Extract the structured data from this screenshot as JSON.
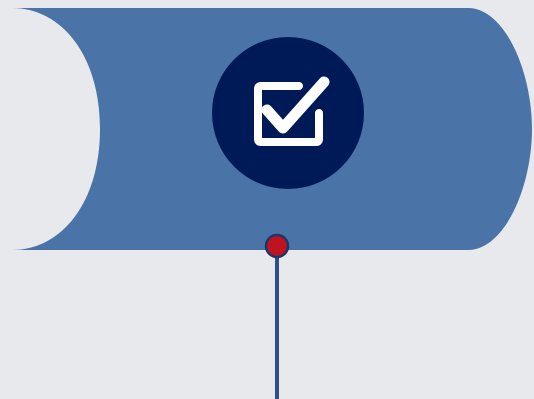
{
  "colors": {
    "background": "#e8e9ed",
    "banner_fill": "#4a74a8",
    "badge_fill": "#001a57",
    "icon_stroke": "#ffffff",
    "connector_line": "#2f4f86",
    "connector_dot": "#c1121f",
    "connector_dot_outline": "#1f3568"
  },
  "icons": {
    "badge_icon": "checkbox-checked-icon"
  }
}
